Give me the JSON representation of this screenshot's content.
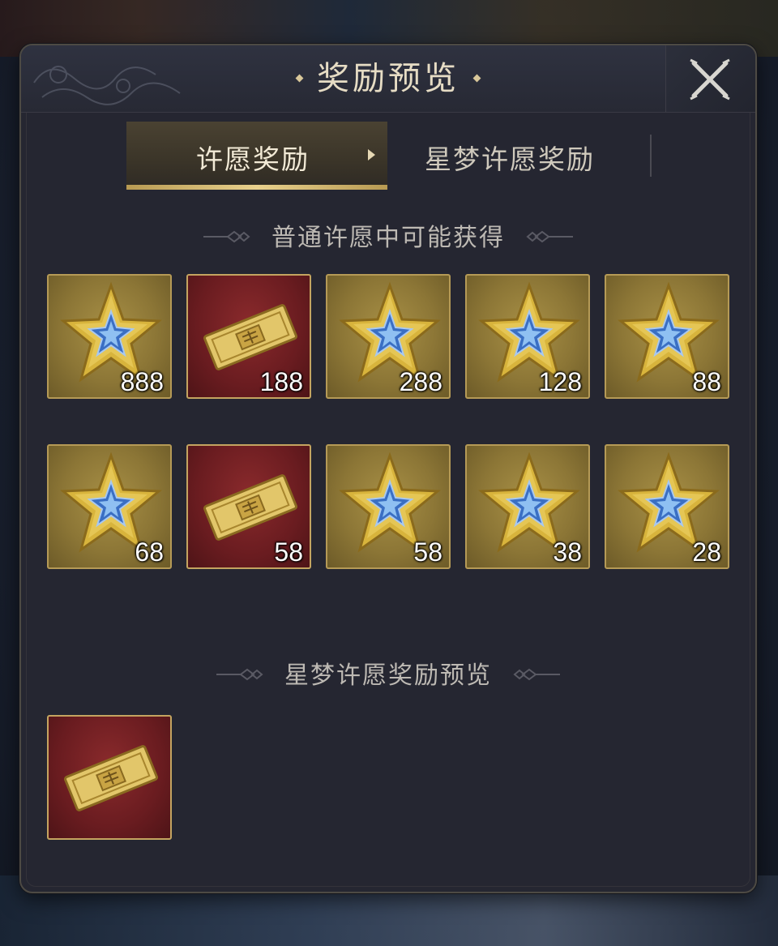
{
  "dialog": {
    "title": "奖励预览",
    "close_icon": "close-x-icon"
  },
  "tabs": [
    {
      "label": "许愿奖励",
      "active": true
    },
    {
      "label": "星梦许愿奖励",
      "active": false
    }
  ],
  "sections": {
    "normal": {
      "heading": "普通许愿中可能获得",
      "items": [
        {
          "icon": "gold-star-icon",
          "qty": "888"
        },
        {
          "icon": "ticket-icon",
          "qty": "188"
        },
        {
          "icon": "gold-star-icon",
          "qty": "288"
        },
        {
          "icon": "gold-star-icon",
          "qty": "128"
        },
        {
          "icon": "gold-star-icon",
          "qty": "88"
        },
        {
          "icon": "gold-star-icon",
          "qty": "68"
        },
        {
          "icon": "ticket-icon",
          "qty": "58"
        },
        {
          "icon": "gold-star-icon",
          "qty": "58"
        },
        {
          "icon": "gold-star-icon",
          "qty": "38"
        },
        {
          "icon": "gold-star-icon",
          "qty": "28"
        }
      ]
    },
    "star_dream": {
      "heading": "星梦许愿奖励预览",
      "items": [
        {
          "icon": "ticket-icon",
          "qty": ""
        }
      ]
    }
  },
  "colors": {
    "panel": "#252631",
    "accent_gold": "#b59a56",
    "gold_tile": "#8c7636",
    "red_tile": "#6a1c20"
  }
}
